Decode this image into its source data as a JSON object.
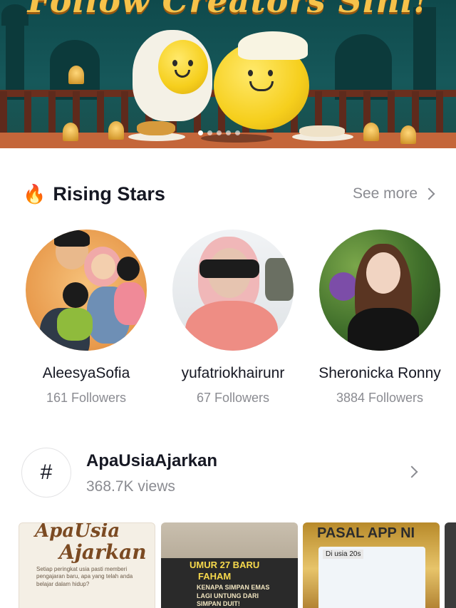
{
  "banner": {
    "title": "Follow Creators Sini!",
    "page_indicator": {
      "count": 5,
      "active": 0
    }
  },
  "rising_stars": {
    "icon": "fire-icon",
    "title": "Rising Stars",
    "see_more": "See more",
    "creators": [
      {
        "name": "AleesyaSofia",
        "followers": "161 Followers"
      },
      {
        "name": "yufatriokhairunr",
        "followers": "67 Followers"
      },
      {
        "name": "Sheronicka Ronny",
        "followers": "3884 Followers"
      }
    ]
  },
  "hashtag": {
    "icon": "hashtag-icon",
    "symbol": "#",
    "name": "ApaUsiaAjarkan",
    "views": "368.7K views"
  },
  "thumbnails": [
    {
      "line1": "ApaUsia",
      "line2": "Ajarkan",
      "line3": "Setiap peringkat usia pasti memberi pengajaran baru, apa yang telah anda belajar dalam hidup?"
    },
    {
      "line1": "UMUR 27 BARU",
      "line2": "FAHAM",
      "line3": "KENAPA SIMPAN EMAS LAGI UNTUNG DARI SIMPAN DUIT!"
    },
    {
      "line1": "PASAL APP NI",
      "line2": "Di usia 20s"
    },
    {}
  ],
  "colors": {
    "banner_bg": "#16585a",
    "banner_title": "#f6c24a",
    "text_primary": "#161823",
    "text_secondary": "#8a8b91"
  }
}
